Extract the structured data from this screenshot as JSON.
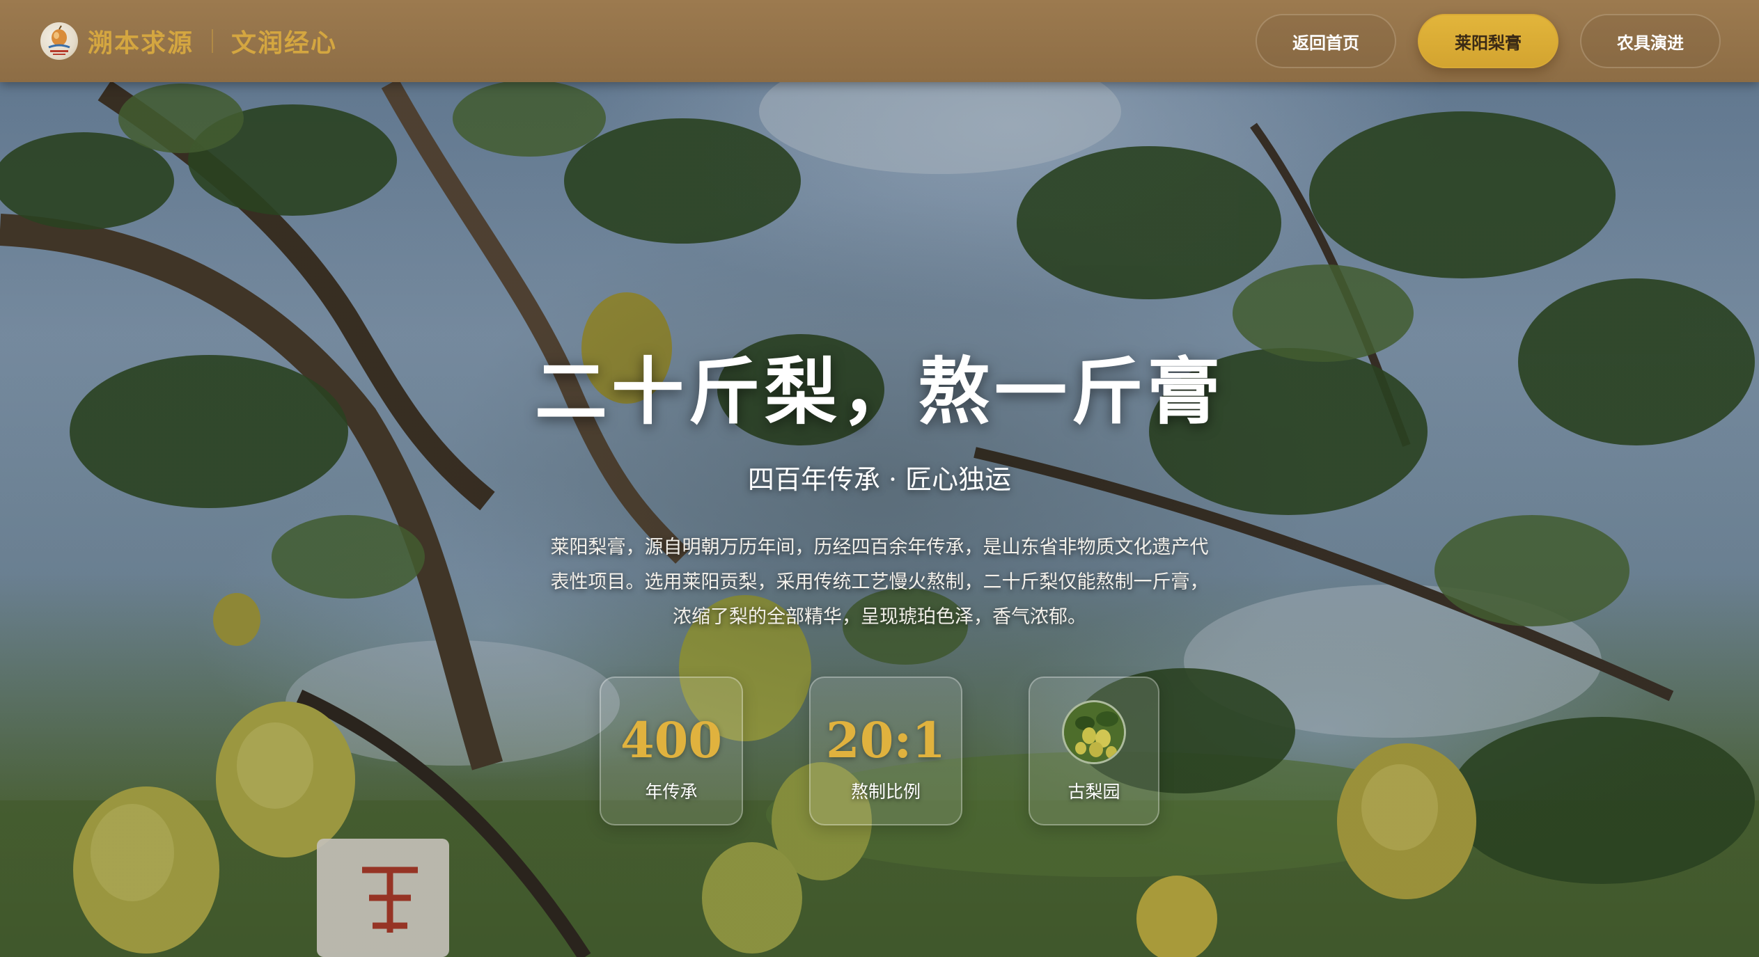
{
  "header": {
    "brand_name": "溯本求源",
    "brand_slogan": "文润经心",
    "logo_icon": "pear-logo-icon",
    "accent_color": "#d4a640"
  },
  "nav": {
    "items": [
      {
        "label": "返回首页",
        "active": false
      },
      {
        "label": "莱阳梨膏",
        "active": true
      },
      {
        "label": "农具演进",
        "active": false
      }
    ]
  },
  "hero": {
    "title": "二十斤梨，熬一斤膏",
    "subtitle": "四百年传承 · 匠心独运",
    "description": "莱阳梨膏，源自明朝万历年间，历经四百余年传承，是山东省非物质文化遗产代表性项目。选用莱阳贡梨，采用传统工艺慢火熬制，二十斤梨仅能熬制一斤膏，浓缩了梨的全部精华，呈现琥珀色泽，香气浓郁。",
    "stats": [
      {
        "value": "400",
        "label": "年传承"
      },
      {
        "value": "20:1",
        "label": "熬制比例"
      },
      {
        "image_icon": "pear-orchard-image",
        "label": "古梨园"
      }
    ]
  }
}
